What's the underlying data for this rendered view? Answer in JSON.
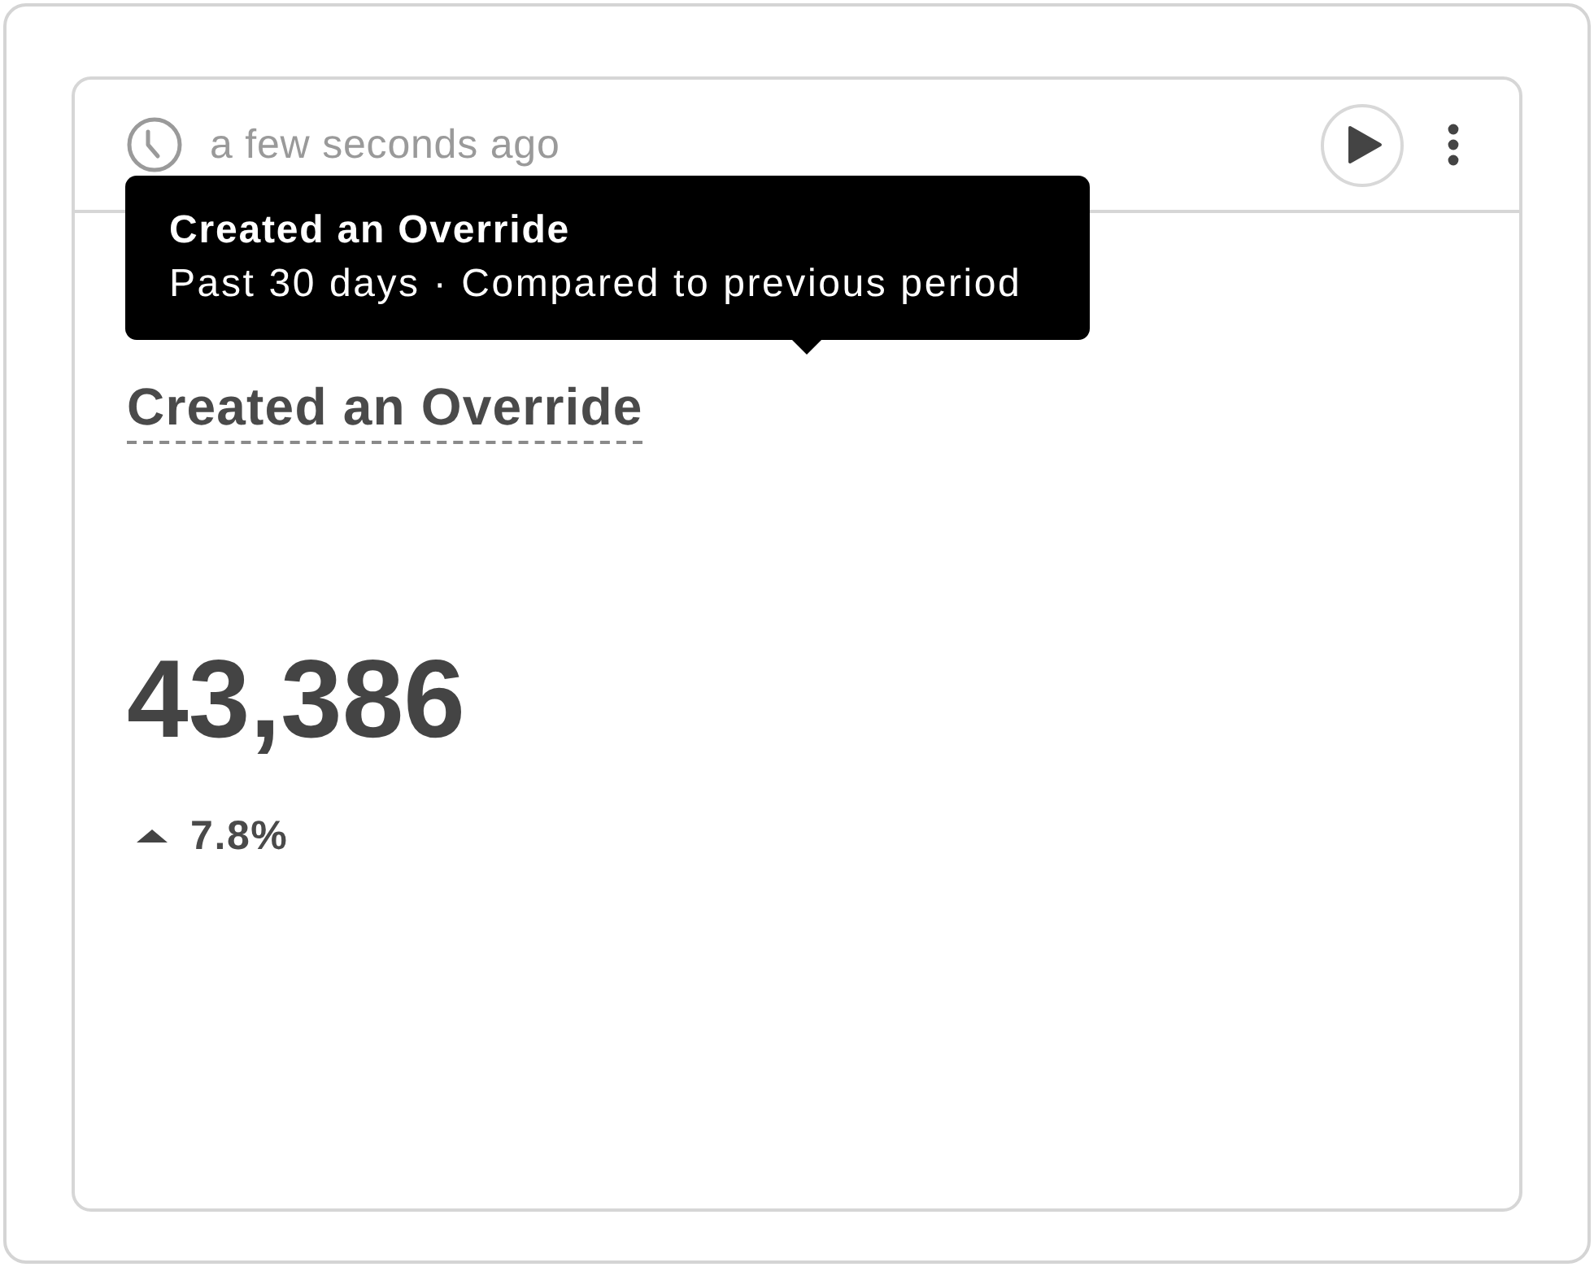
{
  "card": {
    "updated": "a few seconds ago",
    "tooltip": {
      "title": "Created an Override",
      "subtitle": "Past 30 days · Compared to previous period"
    },
    "metric": {
      "title": "Created an Override",
      "value": "43,386",
      "change": {
        "kind": "up",
        "text": "7.8%"
      }
    }
  }
}
